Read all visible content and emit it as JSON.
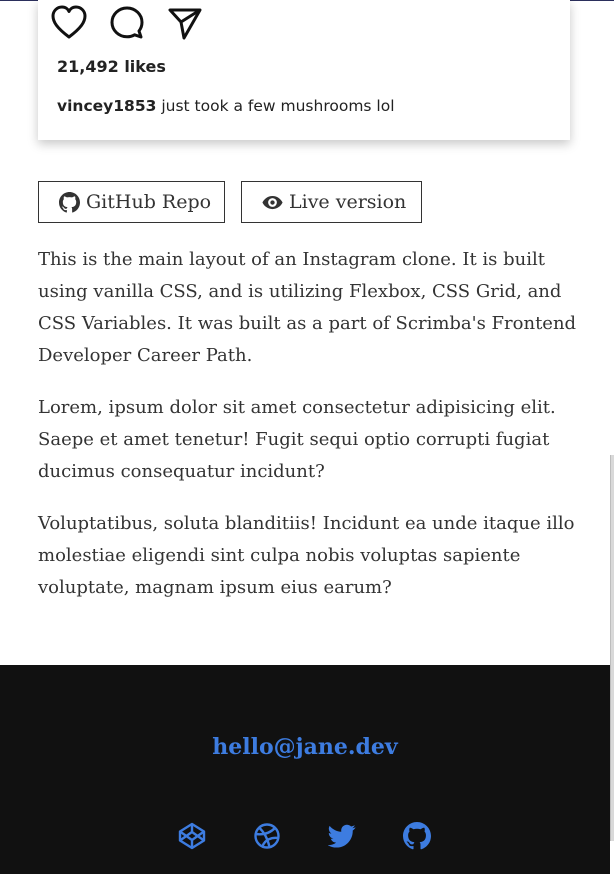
{
  "post": {
    "likes": "21,492 likes",
    "username": "vincey1853",
    "caption": " just took a few mushrooms lol",
    "icons": [
      "heart-icon",
      "comment-icon",
      "share-icon"
    ]
  },
  "buttons": {
    "github_label": "GitHub Repo",
    "live_label": "Live version"
  },
  "description": [
    "This is the main layout of an Instagram clone. It is built using vanilla CSS, and is utilizing Flexbox, CSS Grid, and CSS Variables. It was built as a part of Scrimba's Frontend Developer Career Path.",
    "Lorem, ipsum dolor sit amet consectetur adipisicing elit. Saepe et amet tenetur! Fugit sequi optio corrupti fugiat ducimus consequatur incidunt?",
    "Voluptatibus, soluta blanditiis! Incidunt ea unde itaque illo molestiae eligendi sint culpa nobis voluptas sapiente voluptate, magnam ipsum eius earum?"
  ],
  "footer": {
    "email": "hello@jane.dev",
    "social_icons": [
      "codepen-icon",
      "dribbble-icon",
      "twitter-icon",
      "github-icon"
    ]
  },
  "colors": {
    "accent": "#3d7ce0",
    "footer_bg": "#111111",
    "text": "#333333"
  }
}
